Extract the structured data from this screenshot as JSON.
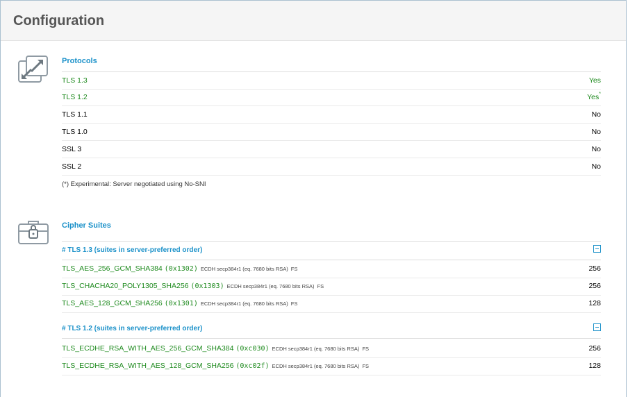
{
  "panel": {
    "title": "Configuration"
  },
  "protocols": {
    "title": "Protocols",
    "icon": "expand-arrows-icon",
    "rows": [
      {
        "label": "TLS 1.3",
        "value": "Yes",
        "status": "enabled",
        "note_mark": ""
      },
      {
        "label": "TLS 1.2",
        "value": "Yes",
        "status": "enabled",
        "note_mark": "*"
      },
      {
        "label": "TLS 1.1",
        "value": "No",
        "status": "disabled",
        "note_mark": ""
      },
      {
        "label": "TLS 1.0",
        "value": "No",
        "status": "disabled",
        "note_mark": ""
      },
      {
        "label": "SSL 3",
        "value": "No",
        "status": "disabled",
        "note_mark": ""
      },
      {
        "label": "SSL 2",
        "value": "No",
        "status": "disabled",
        "note_mark": ""
      }
    ],
    "footnote": "(*) Experimental: Server negotiated using No-SNI"
  },
  "ciphers": {
    "title": "Cipher Suites",
    "icon": "lock-briefcase-icon",
    "groups": [
      {
        "heading": "# TLS 1.3 (suites in server-preferred order)",
        "toggle_icon": "collapse-minus-icon",
        "suites": [
          {
            "name": "TLS_AES_256_GCM_SHA384",
            "code": "(0x1302)",
            "kex": "ECDH secp384r1 (eq. 7680 bits RSA)",
            "fs": "FS",
            "bits": "256"
          },
          {
            "name": "TLS_CHACHA20_POLY1305_SHA256",
            "code": "(0x1303)",
            "kex": "ECDH secp384r1 (eq. 7680 bits RSA)",
            "fs": "FS",
            "bits": "256"
          },
          {
            "name": "TLS_AES_128_GCM_SHA256",
            "code": "(0x1301)",
            "kex": "ECDH secp384r1 (eq. 7680 bits RSA)",
            "fs": "FS",
            "bits": "128"
          }
        ]
      },
      {
        "heading": "# TLS 1.2 (suites in server-preferred order)",
        "toggle_icon": "collapse-minus-icon",
        "suites": [
          {
            "name": "TLS_ECDHE_RSA_WITH_AES_256_GCM_SHA384",
            "code": "(0xc030)",
            "kex": "ECDH secp384r1 (eq. 7680 bits RSA)",
            "fs": "FS",
            "bits": "256"
          },
          {
            "name": "TLS_ECDHE_RSA_WITH_AES_128_GCM_SHA256",
            "code": "(0xc02f)",
            "kex": "ECDH secp384r1 (eq. 7680 bits RSA)",
            "fs": "FS",
            "bits": "128"
          }
        ]
      }
    ]
  },
  "colors": {
    "accent": "#1b91c9",
    "enabled": "#1e8a1e",
    "header_bg": "#f5f5f5",
    "border": "#aac0d0"
  }
}
